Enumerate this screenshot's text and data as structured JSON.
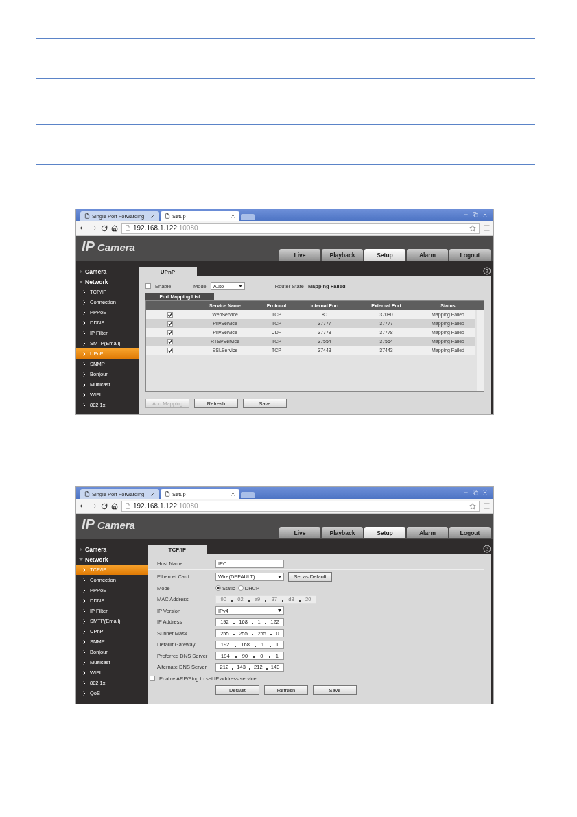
{
  "screenshots": [
    {
      "kind": "upnp",
      "browser_tabs": [
        {
          "label": "Single Port Forwarding",
          "selected": false
        },
        {
          "label": "Setup",
          "selected": true
        }
      ],
      "url": {
        "host": "192.168.1.122",
        "port": ":10080"
      },
      "logo": {
        "main": "IP",
        "sub": "Camera"
      },
      "nav_tabs": [
        {
          "label": "Live",
          "selected": false
        },
        {
          "label": "Playback",
          "selected": false
        },
        {
          "label": "Setup",
          "selected": true
        },
        {
          "label": "Alarm",
          "selected": false
        },
        {
          "label": "Logout",
          "selected": false
        }
      ],
      "sidebar": [
        {
          "label": "Camera",
          "expanded": false
        },
        {
          "label": "Network",
          "expanded": true,
          "children": [
            {
              "label": "TCP/IP",
              "selected": false
            },
            {
              "label": "Connection",
              "selected": false
            },
            {
              "label": "PPPoE",
              "selected": false
            },
            {
              "label": "DDNS",
              "selected": false
            },
            {
              "label": "IP Filter",
              "selected": false
            },
            {
              "label": "SMTP(Email)",
              "selected": false
            },
            {
              "label": "UPnP",
              "selected": true
            },
            {
              "label": "SNMP",
              "selected": false
            },
            {
              "label": "Bonjour",
              "selected": false
            },
            {
              "label": "Multicast",
              "selected": false
            },
            {
              "label": "WIFI",
              "selected": false
            },
            {
              "label": "802.1x",
              "selected": false
            }
          ]
        }
      ],
      "panel_title": "UPnP",
      "enable": {
        "label": "Enable",
        "checked": false
      },
      "mode": {
        "label": "Mode",
        "value": "Auto"
      },
      "router_state": {
        "label": "Router State",
        "value": "Mapping Failed"
      },
      "list_title": "Port Mapping List",
      "columns": [
        "Service Name",
        "Protocol",
        "Internal Port",
        "External Port",
        "Status"
      ],
      "rows": [
        {
          "checked": true,
          "cells": [
            "WebService",
            "TCP",
            "80",
            "37080",
            "Mapping Failed"
          ]
        },
        {
          "checked": true,
          "cells": [
            "PrivService",
            "TCP",
            "37777",
            "37777",
            "Mapping Failed"
          ]
        },
        {
          "checked": true,
          "cells": [
            "PrivService",
            "UDP",
            "37778",
            "37778",
            "Mapping Failed"
          ]
        },
        {
          "checked": true,
          "cells": [
            "RTSPService",
            "TCP",
            "37554",
            "37554",
            "Mapping Failed"
          ]
        },
        {
          "checked": true,
          "cells": [
            "SSLService",
            "TCP",
            "37443",
            "37443",
            "Mapping Failed"
          ]
        }
      ],
      "buttons": [
        {
          "label": "Add Mapping",
          "disabled": true
        },
        {
          "label": "Refresh",
          "disabled": false
        },
        {
          "label": "Save",
          "disabled": false
        }
      ]
    },
    {
      "kind": "tcpip",
      "browser_tabs": [
        {
          "label": "Single Port Forwarding",
          "selected": false
        },
        {
          "label": "Setup",
          "selected": true
        }
      ],
      "url": {
        "host": "192.168.1.122",
        "port": ":10080"
      },
      "logo": {
        "main": "IP",
        "sub": "Camera"
      },
      "nav_tabs": [
        {
          "label": "Live",
          "selected": false
        },
        {
          "label": "Playback",
          "selected": false
        },
        {
          "label": "Setup",
          "selected": true
        },
        {
          "label": "Alarm",
          "selected": false
        },
        {
          "label": "Logout",
          "selected": false
        }
      ],
      "sidebar": [
        {
          "label": "Camera",
          "expanded": false
        },
        {
          "label": "Network",
          "expanded": true,
          "children": [
            {
              "label": "TCP/IP",
              "selected": true
            },
            {
              "label": "Connection",
              "selected": false
            },
            {
              "label": "PPPoE",
              "selected": false
            },
            {
              "label": "DDNS",
              "selected": false
            },
            {
              "label": "IP Filter",
              "selected": false
            },
            {
              "label": "SMTP(Email)",
              "selected": false
            },
            {
              "label": "UPnP",
              "selected": false
            },
            {
              "label": "SNMP",
              "selected": false
            },
            {
              "label": "Bonjour",
              "selected": false
            },
            {
              "label": "Multicast",
              "selected": false
            },
            {
              "label": "WIFI",
              "selected": false
            },
            {
              "label": "802.1x",
              "selected": false
            },
            {
              "label": "QoS",
              "selected": false
            }
          ]
        }
      ],
      "panel_title": "TCP/IP",
      "fields": [
        {
          "kind": "text",
          "label": "Host Name",
          "value": "IPC"
        },
        {
          "kind": "select",
          "label": "Ethernet Card",
          "value": "Wire(DEFAULT)",
          "button": "Set as Default"
        },
        {
          "kind": "radio",
          "label": "Mode",
          "options": [
            {
              "label": "Static",
              "selected": true
            },
            {
              "label": "DHCP",
              "selected": false
            }
          ]
        },
        {
          "kind": "address",
          "label": "MAC Address",
          "disabled": true,
          "parts": [
            "90",
            "02",
            "a9",
            "37",
            "d8",
            "20"
          ]
        },
        {
          "kind": "select",
          "label": "IP Version",
          "value": "IPv4"
        },
        {
          "kind": "address",
          "label": "IP Address",
          "disabled": false,
          "parts": [
            "192",
            "168",
            "1",
            "122"
          ]
        },
        {
          "kind": "address",
          "label": "Subnet Mask",
          "disabled": false,
          "parts": [
            "255",
            "255",
            "255",
            "0"
          ]
        },
        {
          "kind": "address",
          "label": "Default Gateway",
          "disabled": false,
          "parts": [
            "192",
            "168",
            "1",
            "1"
          ]
        },
        {
          "kind": "address",
          "label": "Preferred DNS Server",
          "disabled": false,
          "parts": [
            "194",
            "90",
            "0",
            "1"
          ]
        },
        {
          "kind": "address",
          "label": "Alternate DNS Server",
          "disabled": false,
          "parts": [
            "212",
            "143",
            "212",
            "143"
          ]
        }
      ],
      "arp": {
        "label": "Enable ARP/Ping to set IP address service",
        "checked": false
      },
      "buttons": [
        {
          "label": "Default",
          "disabled": false
        },
        {
          "label": "Refresh",
          "disabled": false
        },
        {
          "label": "Save",
          "disabled": false
        }
      ]
    }
  ]
}
